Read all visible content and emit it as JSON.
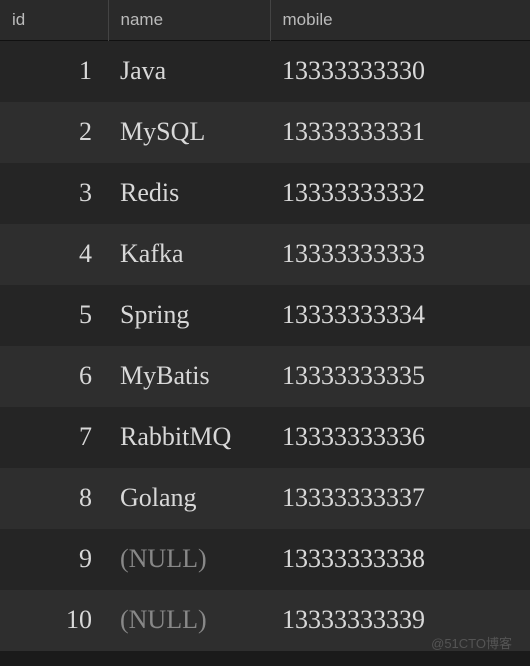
{
  "columns": {
    "id": "id",
    "name": "name",
    "mobile": "mobile"
  },
  "rows": [
    {
      "id": "1",
      "name": "Java",
      "mobile": "13333333330",
      "name_null": false
    },
    {
      "id": "2",
      "name": "MySQL",
      "mobile": "13333333331",
      "name_null": false
    },
    {
      "id": "3",
      "name": "Redis",
      "mobile": "13333333332",
      "name_null": false
    },
    {
      "id": "4",
      "name": "Kafka",
      "mobile": "13333333333",
      "name_null": false
    },
    {
      "id": "5",
      "name": "Spring",
      "mobile": "13333333334",
      "name_null": false
    },
    {
      "id": "6",
      "name": "MyBatis",
      "mobile": "13333333335",
      "name_null": false
    },
    {
      "id": "7",
      "name": "RabbitMQ",
      "mobile": "13333333336",
      "name_null": false
    },
    {
      "id": "8",
      "name": "Golang",
      "mobile": "13333333337",
      "name_null": false
    },
    {
      "id": "9",
      "name": "(NULL)",
      "mobile": "13333333338",
      "name_null": true
    },
    {
      "id": "10",
      "name": "(NULL)",
      "mobile": "13333333339",
      "name_null": true
    }
  ],
  "watermark": "@51CTO博客"
}
